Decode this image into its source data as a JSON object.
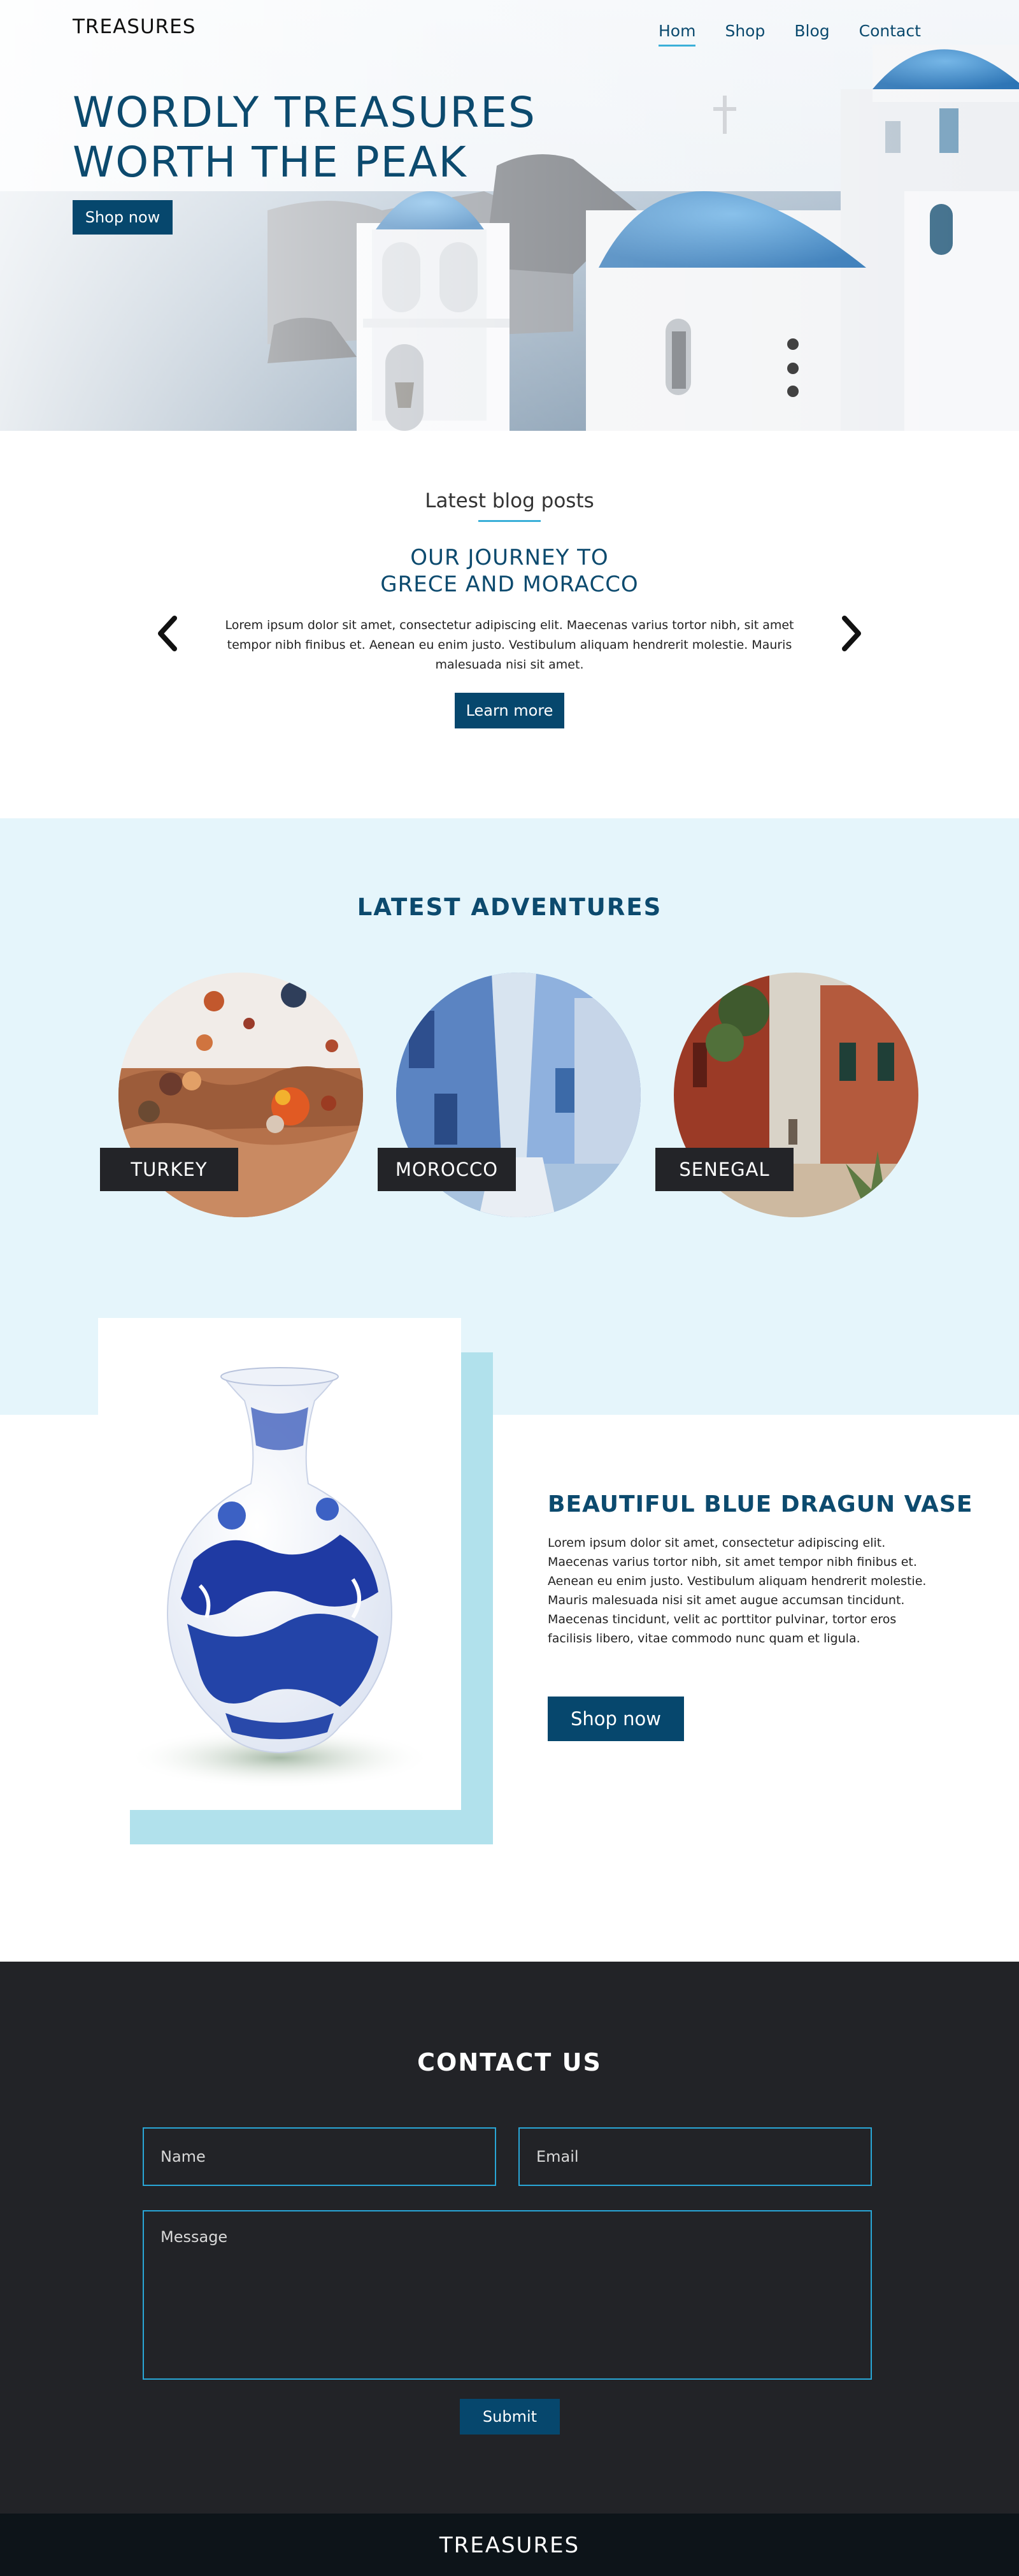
{
  "header": {
    "brand": "TREASURES",
    "nav": [
      {
        "label": "Hom",
        "active": true
      },
      {
        "label": "Shop",
        "active": false
      },
      {
        "label": "Blog",
        "active": false
      },
      {
        "label": "Contact",
        "active": false
      }
    ]
  },
  "hero": {
    "title_line1": "WORDLY TREASURES",
    "title_line2": "WORTH THE PEAK",
    "cta": "Shop now"
  },
  "blog": {
    "heading": "Latest blog posts",
    "post_title_line1": "OUR JOURNEY TO",
    "post_title_line2": "GRECE AND MORACCO",
    "post_body": "Lorem ipsum dolor sit amet, consectetur adipiscing elit. Maecenas varius tortor nibh, sit amet tempor nibh finibus et. Aenean eu enim justo. Vestibulum aliquam hendrerit molestie. Mauris malesuada nisi sit amet.",
    "cta": "Learn more",
    "prev_icon": "chevron-left-icon",
    "next_icon": "chevron-right-icon"
  },
  "adventures": {
    "title": "LATEST ADVENTURES",
    "items": [
      {
        "label": "TURKEY"
      },
      {
        "label": "MOROCCO"
      },
      {
        "label": "SENEGAL"
      }
    ]
  },
  "product": {
    "title": "BEAUTIFUL BLUE DRAGUN VASE",
    "description": "Lorem ipsum dolor sit amet, consectetur adipiscing elit. Maecenas varius tortor nibh, sit amet tempor nibh finibus et. Aenean eu enim justo. Vestibulum aliquam hendrerit molestie. Mauris malesuada nisi sit amet augue accumsan tincidunt. Maecenas tincidunt, velit ac porttitor pulvinar, tortor eros facilisis libero, vitae commodo nunc quam et ligula.",
    "cta": "Shop now"
  },
  "contact": {
    "title": "CONTACT US",
    "name_placeholder": "Name",
    "email_placeholder": "Email",
    "message_placeholder": "Message",
    "submit": "Submit"
  },
  "footer": {
    "brand": "TREASURES"
  },
  "colors": {
    "primary": "#06476d",
    "accent": "#3bb0d8",
    "light_bg": "#e5f5fb",
    "dark_bg": "#222327",
    "footer_bg": "#0d1419"
  }
}
